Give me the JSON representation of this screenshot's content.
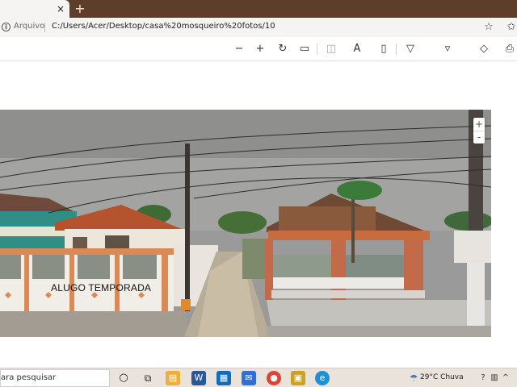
{
  "browser": {
    "tab_close_glyph": "×",
    "new_tab_glyph": "+",
    "source_label": "Arquivo",
    "url": "C:/Users/Acer/Desktop/casa%20mosqueiro%20fotos/10"
  },
  "toolbar_icons": [
    "zoom-out-icon",
    "zoom-in-icon",
    "rotate-icon",
    "fit-page-icon",
    "page-view-icon",
    "read-aloud-icon",
    "immersive-reader-icon",
    "draw-icon",
    "highlight-icon",
    "erase-icon",
    "print-icon"
  ],
  "photo": {
    "sign_text": "ALUGO TEMPORADA",
    "zoom_plus": "+",
    "zoom_minus": "-"
  },
  "taskbar": {
    "search_placeholder": "ara pesquisar",
    "weather": "29°C  Chuva",
    "colors": {
      "explorer": "#e8b23a",
      "word": "#2b579a",
      "store": "#0f6cbd",
      "mail": "#2f6fd6",
      "chrome": "#db4437",
      "app": "#c9a227",
      "edge": "#1f8fd6"
    }
  },
  "colors": {
    "tab_strip": "#5c3e2a",
    "address_bar": "#f6f4f2",
    "taskbar": "#e9e3dc"
  }
}
